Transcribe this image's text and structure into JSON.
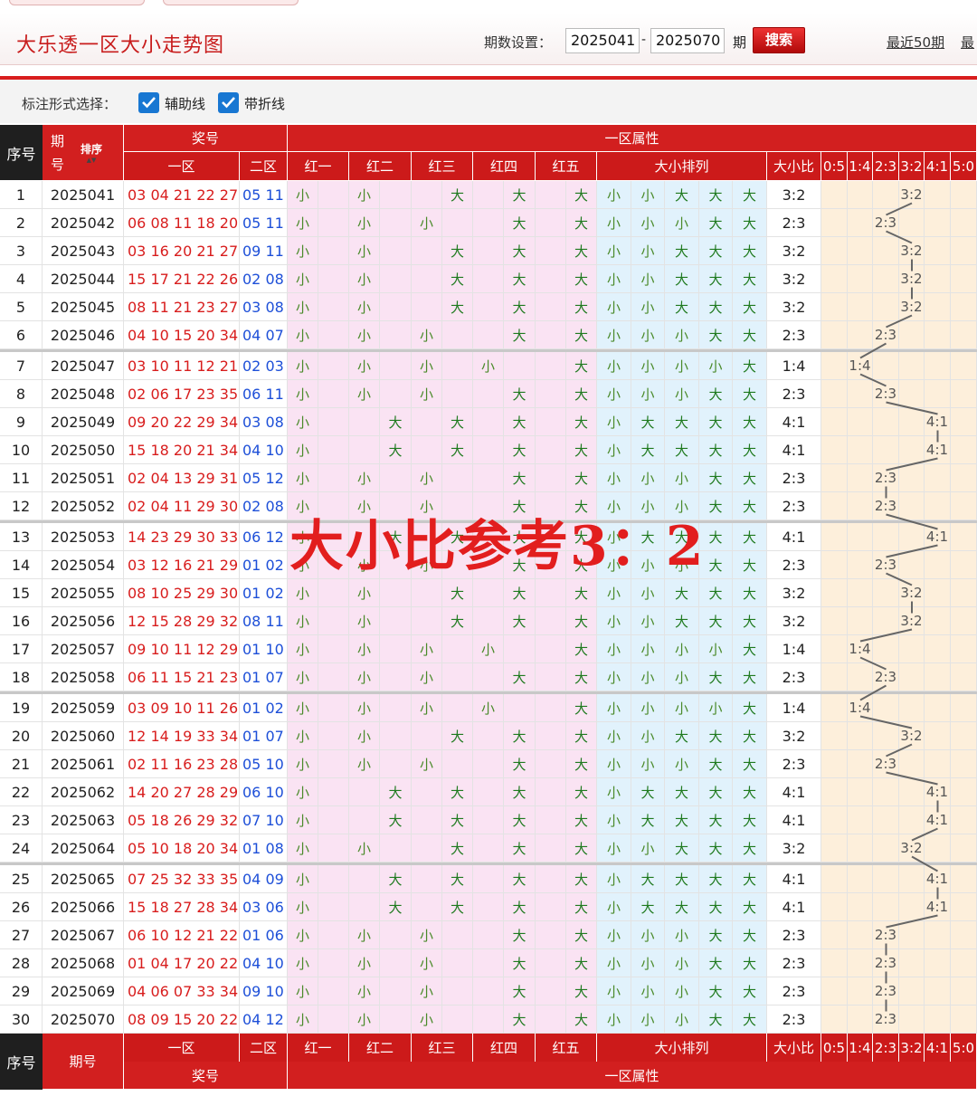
{
  "header": {
    "title": "大乐透一区大小走势图",
    "period_label": "期数设置：",
    "start_value": "2025041",
    "dash": "-",
    "end_value": "2025070",
    "qi_label": "期",
    "search_label": "搜索",
    "recent50_label": "最近50期",
    "recent_more_label": "最"
  },
  "options": {
    "label": "标注形式选择：",
    "aux_line_label": "辅助线",
    "aux_line_checked": true,
    "polyline_label": "带折线",
    "polyline_checked": true
  },
  "table_header": {
    "index": "序号",
    "period": "期号",
    "sort": "排序",
    "prize": "奖号",
    "zone_attr": "一区属性",
    "zone1": "一区",
    "zone2": "二区",
    "reds": [
      "红一",
      "红二",
      "红三",
      "红四",
      "红五"
    ],
    "size_order": "大小排列",
    "ratio": "大小比",
    "ratio_cols": [
      "0:5",
      "1:4",
      "2:3",
      "3:2",
      "4:1",
      "5:0"
    ]
  },
  "small_label": "小",
  "big_label": "大",
  "overlay_text": "大小比参考3：2",
  "colors": {
    "header_red": "#d21f1f",
    "zone1_red": "#d81d1d",
    "zone2_blue": "#1d4fd8",
    "pink": "#fae3f3",
    "blue": "#e1f2fc",
    "amber": "#fdefdb"
  },
  "rows": [
    {
      "i": "1",
      "p": "2025041",
      "z1": "03 04 21 22 27",
      "z2": "05 11",
      "s": "SSBBB",
      "r": "3:2"
    },
    {
      "i": "2",
      "p": "2025042",
      "z1": "06 08 11 18 20",
      "z2": "05 11",
      "s": "SSSBB",
      "r": "2:3"
    },
    {
      "i": "3",
      "p": "2025043",
      "z1": "03 16 20 21 27",
      "z2": "09 11",
      "s": "SSBBB",
      "r": "3:2"
    },
    {
      "i": "4",
      "p": "2025044",
      "z1": "15 17 21 22 26",
      "z2": "02 08",
      "s": "SSBBB",
      "r": "3:2"
    },
    {
      "i": "5",
      "p": "2025045",
      "z1": "08 11 21 23 27",
      "z2": "03 08",
      "s": "SSBBB",
      "r": "3:2"
    },
    {
      "i": "6",
      "p": "2025046",
      "z1": "04 10 15 20 34",
      "z2": "04 07",
      "s": "SSSBB",
      "r": "2:3"
    },
    {
      "i": "7",
      "p": "2025047",
      "z1": "03 10 11 12 21",
      "z2": "02 03",
      "s": "SSSSB",
      "r": "1:4"
    },
    {
      "i": "8",
      "p": "2025048",
      "z1": "02 06 17 23 35",
      "z2": "06 11",
      "s": "SSSBB",
      "r": "2:3"
    },
    {
      "i": "9",
      "p": "2025049",
      "z1": "09 20 22 29 34",
      "z2": "03 08",
      "s": "SBBBB",
      "r": "4:1"
    },
    {
      "i": "10",
      "p": "2025050",
      "z1": "15 18 20 21 34",
      "z2": "04 10",
      "s": "SBBBB",
      "r": "4:1"
    },
    {
      "i": "11",
      "p": "2025051",
      "z1": "02 04 13 29 31",
      "z2": "05 12",
      "s": "SSSBB",
      "r": "2:3"
    },
    {
      "i": "12",
      "p": "2025052",
      "z1": "02 04 11 29 30",
      "z2": "02 08",
      "s": "SSSBB",
      "r": "2:3"
    },
    {
      "i": "13",
      "p": "2025053",
      "z1": "14 23 29 30 33",
      "z2": "06 12",
      "s": "SBBBB",
      "r": "4:1"
    },
    {
      "i": "14",
      "p": "2025054",
      "z1": "03 12 16 21 29",
      "z2": "01 02",
      "s": "SSSBB",
      "r": "2:3"
    },
    {
      "i": "15",
      "p": "2025055",
      "z1": "08 10 25 29 30",
      "z2": "01 02",
      "s": "SSBBB",
      "r": "3:2"
    },
    {
      "i": "16",
      "p": "2025056",
      "z1": "12 15 28 29 32",
      "z2": "08 11",
      "s": "SSBBB",
      "r": "3:2"
    },
    {
      "i": "17",
      "p": "2025057",
      "z1": "09 10 11 12 29",
      "z2": "01 10",
      "s": "SSSSB",
      "r": "1:4"
    },
    {
      "i": "18",
      "p": "2025058",
      "z1": "06 11 15 21 23",
      "z2": "01 07",
      "s": "SSSBB",
      "r": "2:3"
    },
    {
      "i": "19",
      "p": "2025059",
      "z1": "03 09 10 11 26",
      "z2": "01 02",
      "s": "SSSSB",
      "r": "1:4"
    },
    {
      "i": "20",
      "p": "2025060",
      "z1": "12 14 19 33 34",
      "z2": "01 07",
      "s": "SSBBB",
      "r": "3:2"
    },
    {
      "i": "21",
      "p": "2025061",
      "z1": "02 11 16 23 28",
      "z2": "05 10",
      "s": "SSSBB",
      "r": "2:3"
    },
    {
      "i": "22",
      "p": "2025062",
      "z1": "14 20 27 28 29",
      "z2": "06 10",
      "s": "SBBBB",
      "r": "4:1"
    },
    {
      "i": "23",
      "p": "2025063",
      "z1": "05 18 26 29 32",
      "z2": "07 10",
      "s": "SBBBB",
      "r": "4:1"
    },
    {
      "i": "24",
      "p": "2025064",
      "z1": "05 10 18 20 34",
      "z2": "01 08",
      "s": "SSBBB",
      "r": "3:2"
    },
    {
      "i": "25",
      "p": "2025065",
      "z1": "07 25 32 33 35",
      "z2": "04 09",
      "s": "SBBBB",
      "r": "4:1"
    },
    {
      "i": "26",
      "p": "2025066",
      "z1": "15 18 27 28 34",
      "z2": "03 06",
      "s": "SBBBB",
      "r": "4:1"
    },
    {
      "i": "27",
      "p": "2025067",
      "z1": "06 10 12 21 22",
      "z2": "01 06",
      "s": "SSSBB",
      "r": "2:3"
    },
    {
      "i": "28",
      "p": "2025068",
      "z1": "01 04 17 20 22",
      "z2": "04 10",
      "s": "SSSBB",
      "r": "2:3"
    },
    {
      "i": "29",
      "p": "2025069",
      "z1": "04 06 07 33 34",
      "z2": "09 10",
      "s": "SSSBB",
      "r": "2:3"
    },
    {
      "i": "30",
      "p": "2025070",
      "z1": "08 09 15 20 22",
      "z2": "04 12",
      "s": "SSSBB",
      "r": "2:3"
    }
  ]
}
